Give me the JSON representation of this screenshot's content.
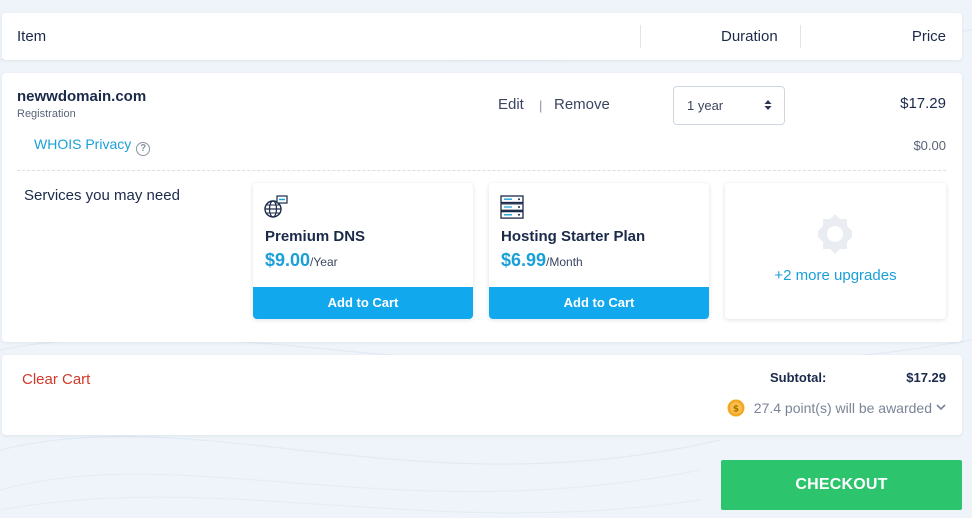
{
  "header": {
    "item_label": "Item",
    "duration_label": "Duration",
    "price_label": "Price"
  },
  "cart_item": {
    "domain": "newwdomain.com",
    "type": "Registration",
    "edit_label": "Edit",
    "divider": "|",
    "remove_label": "Remove",
    "duration_value": "1 year",
    "price": "$17.29",
    "whois_label": "WHOIS Privacy",
    "whois_help": "?",
    "whois_price": "$0.00"
  },
  "services": {
    "label": "Services you may need",
    "items": [
      {
        "title": "Premium DNS",
        "price": "$9.00",
        "period": "/Year",
        "button": "Add to Cart",
        "icon": "globe-dns-icon"
      },
      {
        "title": "Hosting Starter Plan",
        "price": "$6.99",
        "period": "/Month",
        "button": "Add to Cart",
        "icon": "server-icon"
      }
    ],
    "more_label": "+2 more upgrades",
    "more_icon": "gear-icon"
  },
  "totals": {
    "clear_cart": "Clear Cart",
    "subtotal_label": "Subtotal:",
    "subtotal_value": "$17.29",
    "points_text": "27.4 point(s) will be awarded"
  },
  "checkout_label": "CHECKOUT",
  "colors": {
    "accent_blue": "#12a8ee",
    "link_blue": "#1a9fd9",
    "checkout_green": "#2dc46e",
    "danger_red": "#d13a2a",
    "text_dark": "#1b2a4a"
  }
}
